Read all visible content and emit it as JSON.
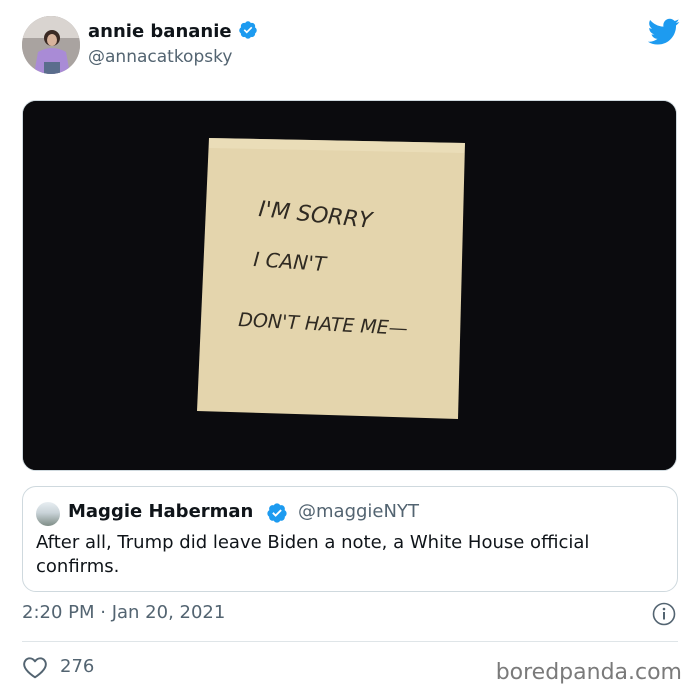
{
  "tweet": {
    "author": {
      "display_name": "annie bananie",
      "handle": "@annacatkopsky",
      "verified": true
    },
    "media": {
      "note_lines": [
        "I'M SORRY",
        "I CAN'T",
        "DON'T HATE ME—"
      ]
    },
    "quoted_tweet": {
      "display_name": "Maggie Haberman",
      "handle": "@maggieNYT",
      "verified": true,
      "text": "After all, Trump did leave Biden a note, a White House official confirms."
    },
    "timestamp": "2:20 PM · Jan 20, 2021",
    "likes": "276"
  },
  "watermark": "boredpanda.com",
  "icons": {
    "platform": "twitter-bird-icon",
    "verified": "verified-badge-icon",
    "info": "info-icon",
    "like": "heart-icon"
  },
  "colors": {
    "twitter_blue": "#1d9bf0",
    "text_primary": "#0f1419",
    "text_secondary": "#536471",
    "border": "#cfd9de",
    "note_paper": "#e4d5ad"
  }
}
